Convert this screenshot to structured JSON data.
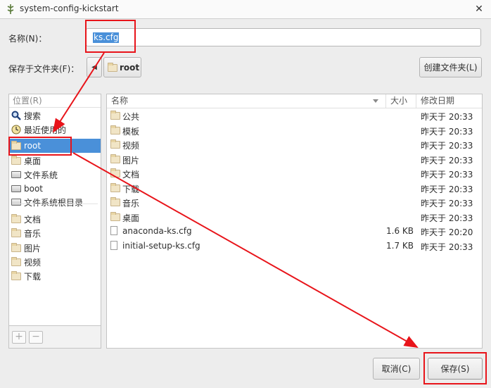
{
  "window": {
    "title": "system-config-kickstart",
    "close_glyph": "✕"
  },
  "name_row": {
    "label": "名称(N)：",
    "value": "ks.cfg"
  },
  "save_in_row": {
    "label": "保存于文件夹(F)：",
    "back_glyph": "◀",
    "path_button": "root",
    "create_folder": "创建文件夹(L)"
  },
  "places": {
    "header": "位置(R)",
    "items": [
      {
        "label": "搜索",
        "icon": "search-icon"
      },
      {
        "label": "最近使用的",
        "icon": "clock-icon"
      },
      {
        "label": "root",
        "icon": "home-folder-icon",
        "selected": true
      },
      {
        "label": "桌面",
        "icon": "folder-icon"
      },
      {
        "label": "文件系统",
        "icon": "drive-icon"
      },
      {
        "label": "boot",
        "icon": "drive-icon"
      },
      {
        "label": "文件系统根目录",
        "icon": "drive-icon"
      },
      {
        "label": "文档",
        "icon": "folder-icon"
      },
      {
        "label": "音乐",
        "icon": "folder-icon"
      },
      {
        "label": "图片",
        "icon": "folder-icon"
      },
      {
        "label": "视频",
        "icon": "folder-icon"
      },
      {
        "label": "下载",
        "icon": "folder-icon"
      }
    ],
    "add_glyph": "+",
    "remove_glyph": "−"
  },
  "files": {
    "columns": {
      "name": "名称",
      "size": "大小",
      "modified": "修改日期"
    },
    "rows": [
      {
        "name": "公共",
        "size": "",
        "modified": "昨天于 20:33",
        "type": "folder"
      },
      {
        "name": "模板",
        "size": "",
        "modified": "昨天于 20:33",
        "type": "folder"
      },
      {
        "name": "视频",
        "size": "",
        "modified": "昨天于 20:33",
        "type": "folder"
      },
      {
        "name": "图片",
        "size": "",
        "modified": "昨天于 20:33",
        "type": "folder"
      },
      {
        "name": "文档",
        "size": "",
        "modified": "昨天于 20:33",
        "type": "folder"
      },
      {
        "name": "下载",
        "size": "",
        "modified": "昨天于 20:33",
        "type": "folder"
      },
      {
        "name": "音乐",
        "size": "",
        "modified": "昨天于 20:33",
        "type": "folder"
      },
      {
        "name": "桌面",
        "size": "",
        "modified": "昨天于 20:33",
        "type": "folder"
      },
      {
        "name": "anaconda-ks.cfg",
        "size": "1.6 KB",
        "modified": "昨天于 20:20",
        "type": "file"
      },
      {
        "name": "initial-setup-ks.cfg",
        "size": "1.7 KB",
        "modified": "昨天于 20:33",
        "type": "file"
      }
    ]
  },
  "buttons": {
    "cancel": "取消(C)",
    "save": "保存(S)"
  },
  "colors": {
    "selection": "#4a90d9",
    "annotation_red": "#e8141a"
  }
}
